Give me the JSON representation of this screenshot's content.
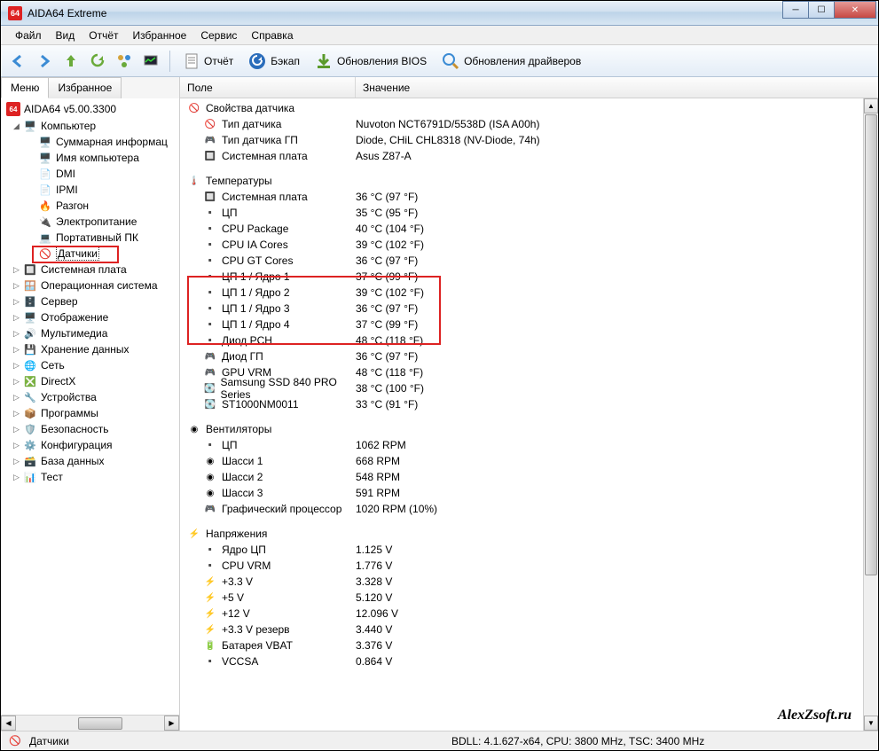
{
  "window": {
    "title": "AIDA64 Extreme",
    "app_icon": "64"
  },
  "menu": [
    "Файл",
    "Вид",
    "Отчёт",
    "Избранное",
    "Сервис",
    "Справка"
  ],
  "toolbar": {
    "report": "Отчёт",
    "backup": "Бэкап",
    "bios": "Обновления BIOS",
    "drivers": "Обновления драйверов"
  },
  "tabs": {
    "menu": "Меню",
    "fav": "Избранное"
  },
  "tree_root": "AIDA64 v5.00.3300",
  "tree": {
    "computer": "Компьютер",
    "computer_children": [
      "Суммарная информац",
      "Имя компьютера",
      "DMI",
      "IPMI",
      "Разгон",
      "Электропитание",
      "Портативный ПК",
      "Датчики"
    ],
    "rest": [
      "Системная плата",
      "Операционная система",
      "Сервер",
      "Отображение",
      "Мультимедиа",
      "Хранение данных",
      "Сеть",
      "DirectX",
      "Устройства",
      "Программы",
      "Безопасность",
      "Конфигурация",
      "База данных",
      "Тест"
    ]
  },
  "columns": {
    "field": "Поле",
    "value": "Значение"
  },
  "sections": {
    "sensor_props": {
      "title": "Свойства датчика",
      "rows": [
        {
          "f": "Тип датчика",
          "v": "Nuvoton NCT6791D/5538D  (ISA A00h)"
        },
        {
          "f": "Тип датчика ГП",
          "v": "Diode, CHiL CHL8318  (NV-Diode, 74h)"
        },
        {
          "f": "Системная плата",
          "v": "Asus Z87-A"
        }
      ]
    },
    "temps": {
      "title": "Температуры",
      "rows": [
        {
          "f": "Системная плата",
          "v": "36 °C  (97 °F)"
        },
        {
          "f": "ЦП",
          "v": "35 °C  (95 °F)"
        },
        {
          "f": "CPU Package",
          "v": "40 °C  (104 °F)"
        },
        {
          "f": "CPU IA Cores",
          "v": "39 °C  (102 °F)"
        },
        {
          "f": "CPU GT Cores",
          "v": "36 °C  (97 °F)"
        },
        {
          "f": "ЦП 1 / Ядро 1",
          "v": "37 °C  (99 °F)"
        },
        {
          "f": "ЦП 1 / Ядро 2",
          "v": "39 °C  (102 °F)"
        },
        {
          "f": "ЦП 1 / Ядро 3",
          "v": "36 °C  (97 °F)"
        },
        {
          "f": "ЦП 1 / Ядро 4",
          "v": "37 °C  (99 °F)"
        },
        {
          "f": "Диод PCH",
          "v": "48 °C  (118 °F)"
        },
        {
          "f": "Диод ГП",
          "v": "36 °C  (97 °F)"
        },
        {
          "f": "GPU VRM",
          "v": "48 °C  (118 °F)"
        },
        {
          "f": "Samsung SSD 840 PRO Series",
          "v": "38 °C  (100 °F)"
        },
        {
          "f": "ST1000NM0011",
          "v": "33 °C  (91 °F)"
        }
      ]
    },
    "fans": {
      "title": "Вентиляторы",
      "rows": [
        {
          "f": "ЦП",
          "v": "1062 RPM"
        },
        {
          "f": "Шасси 1",
          "v": "668 RPM"
        },
        {
          "f": "Шасси 2",
          "v": "548 RPM"
        },
        {
          "f": "Шасси 3",
          "v": "591 RPM"
        },
        {
          "f": "Графический процессор",
          "v": "1020 RPM  (10%)"
        }
      ]
    },
    "volts": {
      "title": "Напряжения",
      "rows": [
        {
          "f": "Ядро ЦП",
          "v": "1.125 V"
        },
        {
          "f": "CPU VRM",
          "v": "1.776 V"
        },
        {
          "f": "+3.3 V",
          "v": "3.328 V"
        },
        {
          "f": "+5 V",
          "v": "5.120 V"
        },
        {
          "f": "+12 V",
          "v": "12.096 V"
        },
        {
          "f": "+3.3 V резерв",
          "v": "3.440 V"
        },
        {
          "f": "Батарея VBAT",
          "v": "3.376 V"
        },
        {
          "f": "VCCSA",
          "v": "0.864 V"
        }
      ]
    }
  },
  "status": {
    "left": "Датчики",
    "right": "BDLL: 4.1.627-x64, CPU: 3800 MHz, TSC: 3400 MHz"
  },
  "watermark": "AlexZsoft.ru"
}
